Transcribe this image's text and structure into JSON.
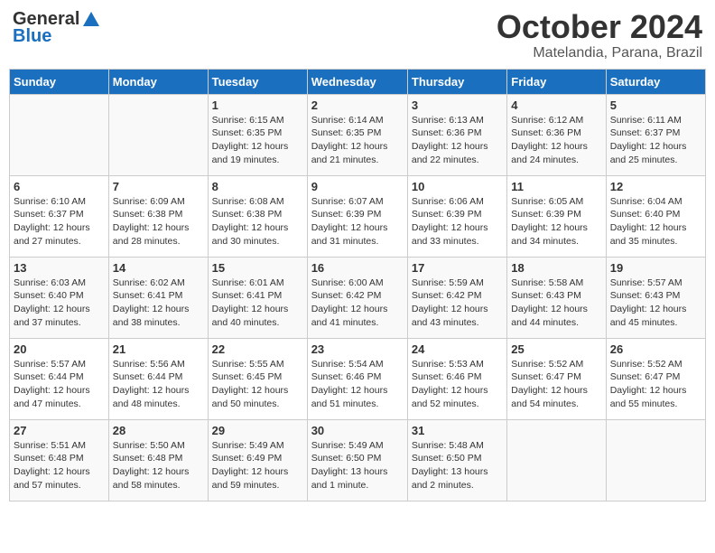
{
  "header": {
    "logo_general": "General",
    "logo_blue": "Blue",
    "month": "October 2024",
    "location": "Matelandia, Parana, Brazil"
  },
  "days_of_week": [
    "Sunday",
    "Monday",
    "Tuesday",
    "Wednesday",
    "Thursday",
    "Friday",
    "Saturday"
  ],
  "weeks": [
    [
      {
        "day": "",
        "info": ""
      },
      {
        "day": "",
        "info": ""
      },
      {
        "day": "1",
        "sunrise": "Sunrise: 6:15 AM",
        "sunset": "Sunset: 6:35 PM",
        "daylight": "Daylight: 12 hours and 19 minutes."
      },
      {
        "day": "2",
        "sunrise": "Sunrise: 6:14 AM",
        "sunset": "Sunset: 6:35 PM",
        "daylight": "Daylight: 12 hours and 21 minutes."
      },
      {
        "day": "3",
        "sunrise": "Sunrise: 6:13 AM",
        "sunset": "Sunset: 6:36 PM",
        "daylight": "Daylight: 12 hours and 22 minutes."
      },
      {
        "day": "4",
        "sunrise": "Sunrise: 6:12 AM",
        "sunset": "Sunset: 6:36 PM",
        "daylight": "Daylight: 12 hours and 24 minutes."
      },
      {
        "day": "5",
        "sunrise": "Sunrise: 6:11 AM",
        "sunset": "Sunset: 6:37 PM",
        "daylight": "Daylight: 12 hours and 25 minutes."
      }
    ],
    [
      {
        "day": "6",
        "sunrise": "Sunrise: 6:10 AM",
        "sunset": "Sunset: 6:37 PM",
        "daylight": "Daylight: 12 hours and 27 minutes."
      },
      {
        "day": "7",
        "sunrise": "Sunrise: 6:09 AM",
        "sunset": "Sunset: 6:38 PM",
        "daylight": "Daylight: 12 hours and 28 minutes."
      },
      {
        "day": "8",
        "sunrise": "Sunrise: 6:08 AM",
        "sunset": "Sunset: 6:38 PM",
        "daylight": "Daylight: 12 hours and 30 minutes."
      },
      {
        "day": "9",
        "sunrise": "Sunrise: 6:07 AM",
        "sunset": "Sunset: 6:39 PM",
        "daylight": "Daylight: 12 hours and 31 minutes."
      },
      {
        "day": "10",
        "sunrise": "Sunrise: 6:06 AM",
        "sunset": "Sunset: 6:39 PM",
        "daylight": "Daylight: 12 hours and 33 minutes."
      },
      {
        "day": "11",
        "sunrise": "Sunrise: 6:05 AM",
        "sunset": "Sunset: 6:39 PM",
        "daylight": "Daylight: 12 hours and 34 minutes."
      },
      {
        "day": "12",
        "sunrise": "Sunrise: 6:04 AM",
        "sunset": "Sunset: 6:40 PM",
        "daylight": "Daylight: 12 hours and 35 minutes."
      }
    ],
    [
      {
        "day": "13",
        "sunrise": "Sunrise: 6:03 AM",
        "sunset": "Sunset: 6:40 PM",
        "daylight": "Daylight: 12 hours and 37 minutes."
      },
      {
        "day": "14",
        "sunrise": "Sunrise: 6:02 AM",
        "sunset": "Sunset: 6:41 PM",
        "daylight": "Daylight: 12 hours and 38 minutes."
      },
      {
        "day": "15",
        "sunrise": "Sunrise: 6:01 AM",
        "sunset": "Sunset: 6:41 PM",
        "daylight": "Daylight: 12 hours and 40 minutes."
      },
      {
        "day": "16",
        "sunrise": "Sunrise: 6:00 AM",
        "sunset": "Sunset: 6:42 PM",
        "daylight": "Daylight: 12 hours and 41 minutes."
      },
      {
        "day": "17",
        "sunrise": "Sunrise: 5:59 AM",
        "sunset": "Sunset: 6:42 PM",
        "daylight": "Daylight: 12 hours and 43 minutes."
      },
      {
        "day": "18",
        "sunrise": "Sunrise: 5:58 AM",
        "sunset": "Sunset: 6:43 PM",
        "daylight": "Daylight: 12 hours and 44 minutes."
      },
      {
        "day": "19",
        "sunrise": "Sunrise: 5:57 AM",
        "sunset": "Sunset: 6:43 PM",
        "daylight": "Daylight: 12 hours and 45 minutes."
      }
    ],
    [
      {
        "day": "20",
        "sunrise": "Sunrise: 5:57 AM",
        "sunset": "Sunset: 6:44 PM",
        "daylight": "Daylight: 12 hours and 47 minutes."
      },
      {
        "day": "21",
        "sunrise": "Sunrise: 5:56 AM",
        "sunset": "Sunset: 6:44 PM",
        "daylight": "Daylight: 12 hours and 48 minutes."
      },
      {
        "day": "22",
        "sunrise": "Sunrise: 5:55 AM",
        "sunset": "Sunset: 6:45 PM",
        "daylight": "Daylight: 12 hours and 50 minutes."
      },
      {
        "day": "23",
        "sunrise": "Sunrise: 5:54 AM",
        "sunset": "Sunset: 6:46 PM",
        "daylight": "Daylight: 12 hours and 51 minutes."
      },
      {
        "day": "24",
        "sunrise": "Sunrise: 5:53 AM",
        "sunset": "Sunset: 6:46 PM",
        "daylight": "Daylight: 12 hours and 52 minutes."
      },
      {
        "day": "25",
        "sunrise": "Sunrise: 5:52 AM",
        "sunset": "Sunset: 6:47 PM",
        "daylight": "Daylight: 12 hours and 54 minutes."
      },
      {
        "day": "26",
        "sunrise": "Sunrise: 5:52 AM",
        "sunset": "Sunset: 6:47 PM",
        "daylight": "Daylight: 12 hours and 55 minutes."
      }
    ],
    [
      {
        "day": "27",
        "sunrise": "Sunrise: 5:51 AM",
        "sunset": "Sunset: 6:48 PM",
        "daylight": "Daylight: 12 hours and 57 minutes."
      },
      {
        "day": "28",
        "sunrise": "Sunrise: 5:50 AM",
        "sunset": "Sunset: 6:48 PM",
        "daylight": "Daylight: 12 hours and 58 minutes."
      },
      {
        "day": "29",
        "sunrise": "Sunrise: 5:49 AM",
        "sunset": "Sunset: 6:49 PM",
        "daylight": "Daylight: 12 hours and 59 minutes."
      },
      {
        "day": "30",
        "sunrise": "Sunrise: 5:49 AM",
        "sunset": "Sunset: 6:50 PM",
        "daylight": "Daylight: 13 hours and 1 minute."
      },
      {
        "day": "31",
        "sunrise": "Sunrise: 5:48 AM",
        "sunset": "Sunset: 6:50 PM",
        "daylight": "Daylight: 13 hours and 2 minutes."
      },
      {
        "day": "",
        "info": ""
      },
      {
        "day": "",
        "info": ""
      }
    ]
  ]
}
